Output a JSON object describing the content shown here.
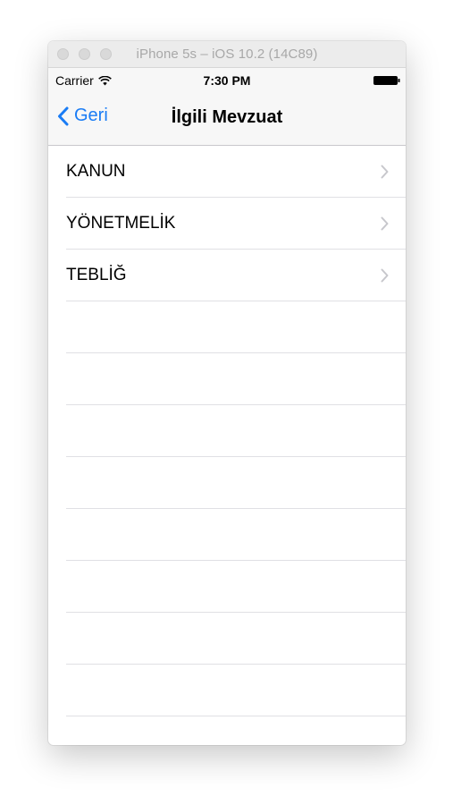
{
  "simulator": {
    "window_title": "iPhone 5s – iOS 10.2 (14C89)"
  },
  "status_bar": {
    "carrier": "Carrier",
    "time": "7:30 PM",
    "wifi_icon": "wifi-icon",
    "battery_icon": "battery-icon"
  },
  "nav_bar": {
    "back_label": "Geri",
    "back_icon": "chevron-left-icon",
    "title": "İlgili Mevzuat",
    "tint_color": "#1a7cf5"
  },
  "list": {
    "items": [
      {
        "label": "KANUN",
        "accessory_icon": "chevron-right-icon"
      },
      {
        "label": "YÖNETMELİK",
        "accessory_icon": "chevron-right-icon"
      },
      {
        "label": "TEBLİĞ",
        "accessory_icon": "chevron-right-icon"
      }
    ]
  }
}
